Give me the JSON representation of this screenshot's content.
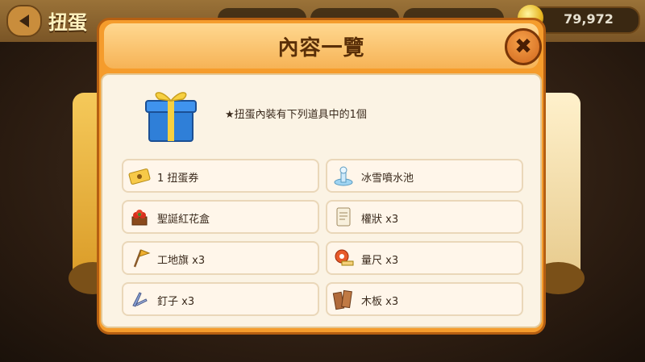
{
  "background": {
    "title": "扭蛋",
    "coins": "79,972"
  },
  "dialog": {
    "title": "內容一覽",
    "close_icon": "close-x-icon",
    "intro_text": "★扭蛋內裝有下列道具中的1個",
    "gift_icon": "blue-gift-box-icon",
    "items": [
      {
        "label": "1 扭蛋券",
        "icon": "gacha-ticket-icon"
      },
      {
        "label": "冰雪噴水池",
        "icon": "snow-fountain-icon"
      },
      {
        "label": "聖誕紅花盒",
        "icon": "poinsettia-box-icon"
      },
      {
        "label": "權狀 x3",
        "icon": "deed-scroll-icon"
      },
      {
        "label": "工地旗 x3",
        "icon": "construction-flag-icon"
      },
      {
        "label": "量尺 x3",
        "icon": "measuring-tape-icon"
      },
      {
        "label": "釘子 x3",
        "icon": "nail-icon"
      },
      {
        "label": "木板 x3",
        "icon": "wood-plank-icon"
      }
    ]
  },
  "colors": {
    "dialog_orange": "#f59c2c",
    "title_brown": "#5a2f08",
    "panel_cream": "#fbf3e4"
  }
}
